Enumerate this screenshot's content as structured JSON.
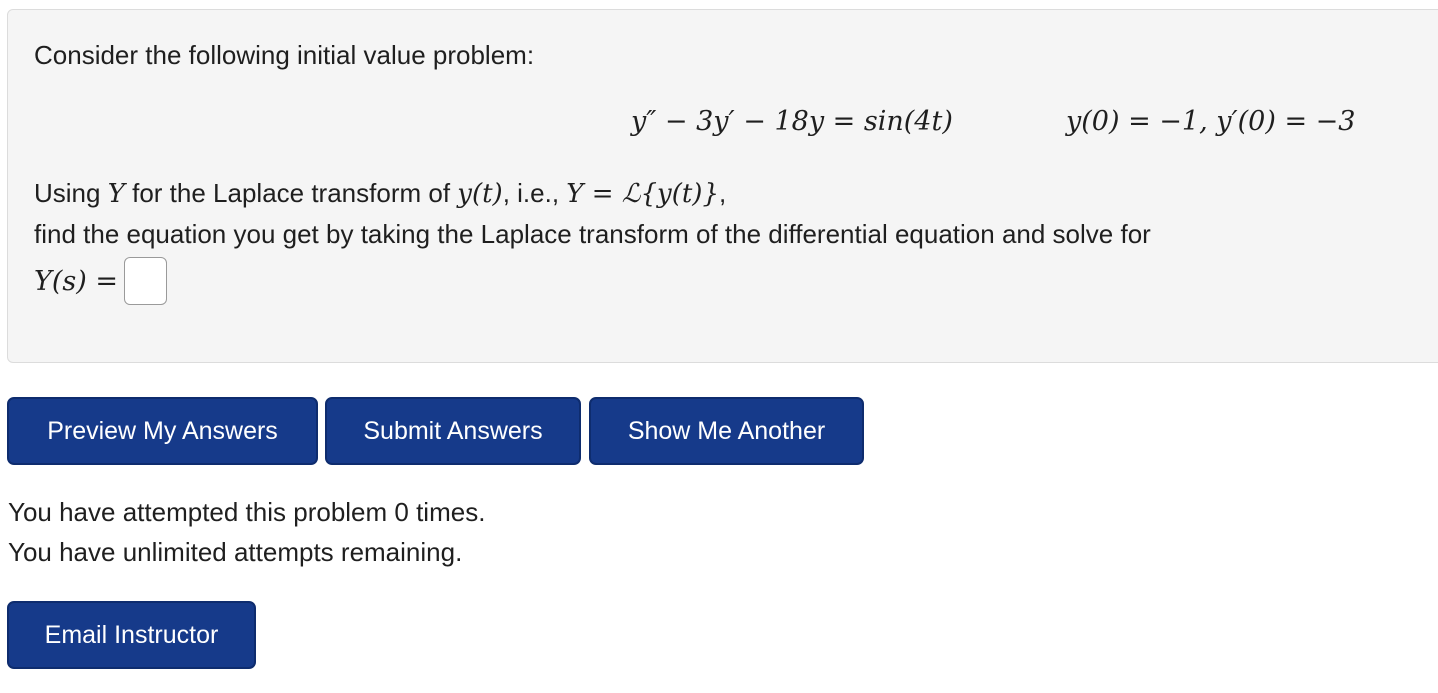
{
  "problem": {
    "intro": "Consider the following initial value problem:",
    "equation": "y″ − 3y′ − 18y = sin(4t)",
    "initial_conditions": "y(0) = −1,  y′(0) = −3",
    "using_prefix": "Using ",
    "using_Y": "Y",
    "using_mid": " for the Laplace transform of ",
    "using_yt": "y(t)",
    "using_ie": ", i.e., ",
    "using_def": "Y = ℒ{y(t)}",
    "using_suffix": ",",
    "instruction": "find the equation you get by taking the Laplace transform of the differential equation and solve for",
    "answer_label": "Y(s) =",
    "answer_value": ""
  },
  "buttons": {
    "preview": "Preview My Answers",
    "submit": "Submit Answers",
    "another": "Show Me Another",
    "email": "Email Instructor"
  },
  "status": {
    "attempted": "You have attempted this problem 0 times.",
    "remaining": "You have unlimited attempts remaining."
  },
  "colors": {
    "button_bg": "#163a8a",
    "panel_bg": "#f5f5f5"
  }
}
